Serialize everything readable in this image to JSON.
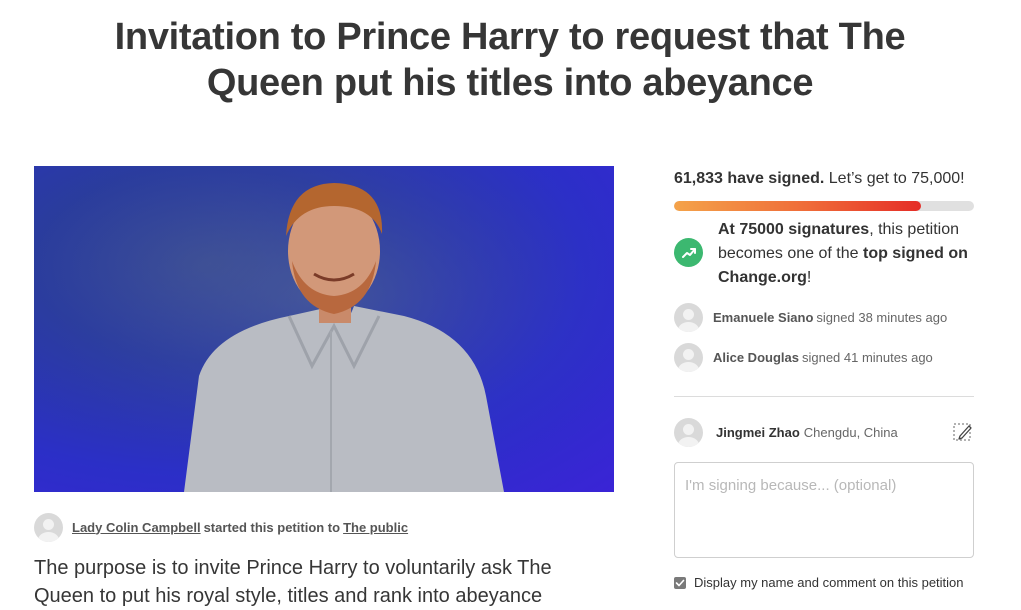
{
  "petition": {
    "title": "Invitation to Prince Harry to request that The Queen put his titles into abeyance",
    "starter_name": "Lady Colin Campbell",
    "starter_mid": "started this petition to",
    "target": "The public",
    "description": "The purpose is to invite Prince Harry to voluntarily ask The Queen to put his royal style, titles and rank into abeyance"
  },
  "signatures": {
    "count_text": "61,833 have signed.",
    "goal_text": "Let’s get to 75,000!",
    "progress_fraction": 0.8244,
    "milestone_strong": "At 75000 signatures",
    "milestone_mid": ", this petition becomes one of the ",
    "milestone_strong2": "top signed on Change.org",
    "milestone_end": "!",
    "accent_color": "#3cb870"
  },
  "recent_signers": [
    {
      "name": "Emanuele Siano",
      "action": "signed 38 minutes ago"
    },
    {
      "name": "Alice Douglas",
      "action": "signed 41 minutes ago"
    }
  ],
  "signing_user": {
    "name": "Jingmei Zhao",
    "location": "Chengdu, China"
  },
  "form": {
    "comment_placeholder": "I'm signing because... (optional)",
    "display_label": "Display my name and comment on this petition",
    "display_checked": true
  },
  "icons": {
    "trend": "trending-up-icon",
    "edit": "edit-pencil-icon",
    "check": "checkmark-icon"
  }
}
